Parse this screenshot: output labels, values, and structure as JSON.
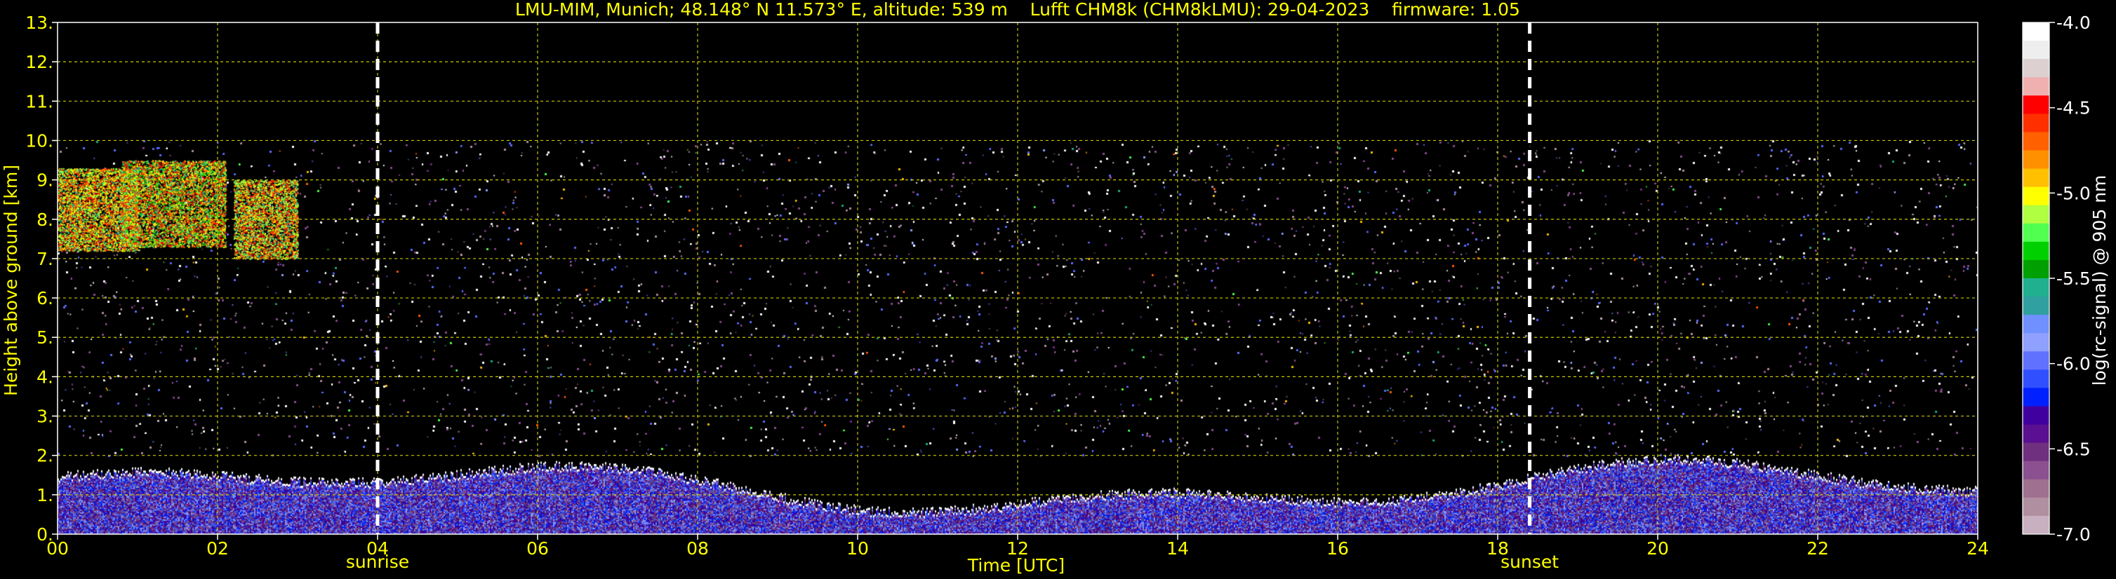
{
  "chart_data": {
    "type": "heatmap",
    "title": "LMU-MIM, Munich; 48.148° N 11.573° E, altitude: 539 m    Lufft CHM8k (CHM8kLMU): 29-04-2023    firmware: 1.05",
    "xlabel": "Time [UTC]",
    "ylabel": "Height above ground [km]",
    "colorbar_label": "log(rc-signal) @ 905 nm",
    "xlim": [
      0,
      24
    ],
    "ylim": [
      0,
      13
    ],
    "x_ticks": [
      0,
      2,
      4,
      6,
      8,
      10,
      12,
      14,
      16,
      18,
      20,
      22,
      24
    ],
    "x_tick_labels": [
      "00",
      "02",
      "04",
      "06",
      "08",
      "10",
      "12",
      "14",
      "16",
      "18",
      "20",
      "22",
      "24"
    ],
    "y_ticks": [
      0,
      1,
      2,
      3,
      4,
      5,
      6,
      7,
      8,
      9,
      10,
      11,
      12,
      13
    ],
    "y_tick_labels": [
      "0.",
      "1.",
      "2.",
      "3.",
      "4.",
      "5.",
      "6.",
      "7.",
      "8.",
      "9.",
      "10.",
      "11.",
      "12.",
      "13."
    ],
    "grid": true,
    "colorbar": {
      "min": -7.0,
      "max": -4.0,
      "ticks": [
        -4.0,
        -4.5,
        -5.0,
        -5.5,
        -6.0,
        -6.5,
        -7.0
      ],
      "tick_labels": [
        "-4.0",
        "-4.5",
        "-5.0",
        "-5.5",
        "-6.0",
        "-6.5",
        "-7.0"
      ],
      "colors": [
        "#ffffff",
        "#eeeeee",
        "#ddd0d0",
        "#f0b0b0",
        "#ff0000",
        "#ff3000",
        "#ff6000",
        "#ff9000",
        "#ffc000",
        "#ffff00",
        "#b0ff40",
        "#50ff50",
        "#00d000",
        "#00a000",
        "#20b090",
        "#30a0a0",
        "#7090ff",
        "#90a0ff",
        "#6070ff",
        "#3050ff",
        "#0020ff",
        "#4000a0",
        "#5a1090",
        "#703080",
        "#8a5090",
        "#a07090",
        "#b090a0",
        "#c8b0c0"
      ]
    },
    "markers": [
      {
        "x": 4.0,
        "label": "sunrise",
        "style": "dashed",
        "color": "#ffffff"
      },
      {
        "x": 18.4,
        "label": "sunset",
        "style": "dashed",
        "color": "#ffffff"
      }
    ],
    "data_top_km": 10.0,
    "features": [
      {
        "type": "cirrus_cloud",
        "x_range": [
          0,
          1.0
        ],
        "y_range": [
          7.2,
          9.3
        ],
        "level": -5.0
      },
      {
        "type": "cirrus_cloud",
        "x_range": [
          0.8,
          2.1
        ],
        "y_range": [
          7.3,
          9.5
        ],
        "level": -5.3
      },
      {
        "type": "cirrus_cloud",
        "x_range": [
          2.2,
          3.0
        ],
        "y_range": [
          7.0,
          9.0
        ],
        "level": -5.1
      },
      {
        "type": "boundary_layer",
        "x_range": [
          0,
          24
        ],
        "y_range": [
          0,
          1.8
        ],
        "level": -6.2
      }
    ],
    "colors": {
      "grid": "#c8c800",
      "text": "#ffff00",
      "axis_label_right": "#ffffff",
      "background": "#000000"
    }
  }
}
